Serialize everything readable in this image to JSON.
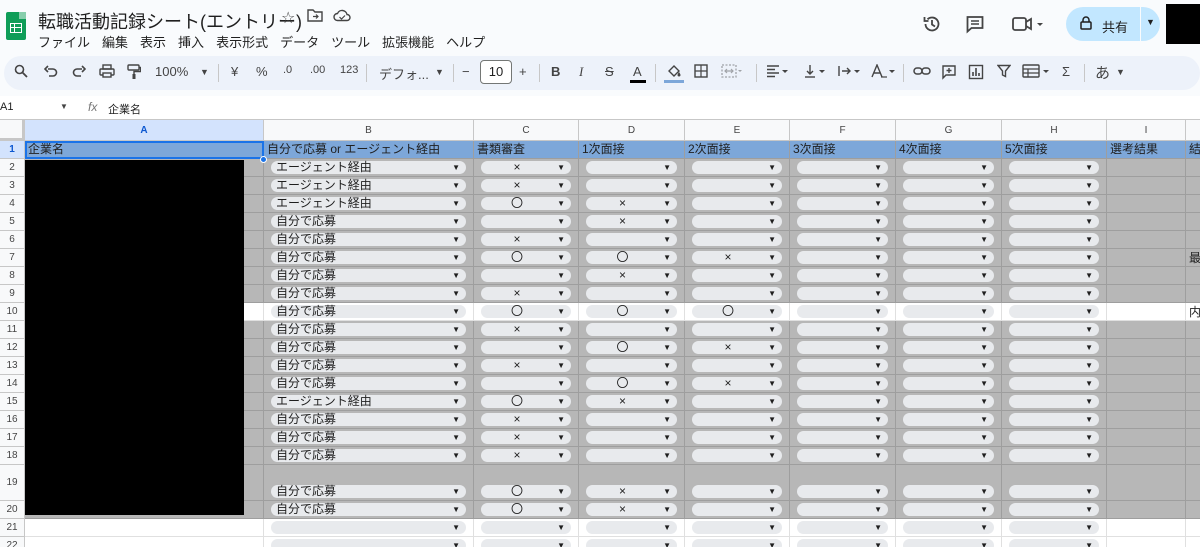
{
  "app": {
    "doc_title": "転職活動記録シート(エントリー)",
    "menu": [
      "ファイル",
      "編集",
      "表示",
      "挿入",
      "表示形式",
      "データ",
      "ツール",
      "拡張機能",
      "ヘルプ"
    ],
    "share_label": "共有"
  },
  "toolbar": {
    "zoom": "100%",
    "currency": "¥",
    "percent": "%",
    "dec_decrease": ".0",
    "dec_increase": ".00",
    "number_format": "123",
    "font": "デフォ...",
    "font_size": "10",
    "bold": "B",
    "italic": "I",
    "strike": "S",
    "text_color": "A",
    "ime": "あ"
  },
  "formula_bar": {
    "name_box": "A1",
    "fx": "fx",
    "value": "企業名"
  },
  "colors": {
    "header_fill": "#7da7d9",
    "row_fill": "#b7b7b7",
    "selection": "#1a73e8"
  },
  "sheet": {
    "columns": [
      "A",
      "B",
      "C",
      "D",
      "E",
      "F",
      "G",
      "H",
      "I"
    ],
    "header_row": [
      "企業名",
      "自分で応募 or エージェント経由",
      "書類審査",
      "1次面接",
      "2次面接",
      "3次面接",
      "4次面接",
      "5次面接",
      "選考結果",
      "結"
    ],
    "row_numbers": [
      "1",
      "2",
      "3",
      "4",
      "5",
      "6",
      "7",
      "8",
      "9",
      "10",
      "11",
      "12",
      "13",
      "14",
      "15",
      "16",
      "17",
      "18",
      "19",
      "20",
      "21",
      "22"
    ],
    "rows": [
      {
        "b": "エージェント経由",
        "c": "×",
        "d": "",
        "e": "",
        "j": ""
      },
      {
        "b": "エージェント経由",
        "c": "×",
        "d": "",
        "e": "",
        "j": ""
      },
      {
        "b": "エージェント経由",
        "c": "〇",
        "d": "×",
        "e": "",
        "j": ""
      },
      {
        "b": "自分で応募",
        "c": "",
        "d": "×",
        "e": "",
        "j": ""
      },
      {
        "b": "自分で応募",
        "c": "×",
        "d": "",
        "e": "",
        "j": ""
      },
      {
        "b": "自分で応募",
        "c": "〇",
        "d": "〇",
        "e": "×",
        "j": "最"
      },
      {
        "b": "自分で応募",
        "c": "",
        "d": "×",
        "e": "",
        "j": ""
      },
      {
        "b": "自分で応募",
        "c": "×",
        "d": "",
        "e": "",
        "j": ""
      },
      {
        "b": "自分で応募",
        "c": "〇",
        "d": "〇",
        "e": "〇",
        "j": "内"
      },
      {
        "b": "自分で応募",
        "c": "×",
        "d": "",
        "e": "",
        "j": ""
      },
      {
        "b": "自分で応募",
        "c": "",
        "d": "〇",
        "e": "×",
        "j": ""
      },
      {
        "b": "自分で応募",
        "c": "×",
        "d": "",
        "e": "",
        "j": ""
      },
      {
        "b": "自分で応募",
        "c": "",
        "d": "〇",
        "e": "×",
        "j": ""
      },
      {
        "b": "エージェント経由",
        "c": "〇",
        "d": "×",
        "e": "",
        "j": ""
      },
      {
        "b": "自分で応募",
        "c": "×",
        "d": "",
        "e": "",
        "j": ""
      },
      {
        "b": "自分で応募",
        "c": "×",
        "d": "",
        "e": "",
        "j": ""
      },
      {
        "b": "自分で応募",
        "c": "×",
        "d": "",
        "e": "",
        "j": ""
      },
      {
        "b": "自分で応募",
        "c": "〇",
        "d": "×",
        "e": "",
        "j": ""
      },
      {
        "b": "自分で応募",
        "c": "〇",
        "d": "×",
        "e": "",
        "j": ""
      },
      {
        "b": "",
        "c": "",
        "d": "",
        "e": "",
        "j": ""
      },
      {
        "b": "",
        "c": "",
        "d": "",
        "e": "",
        "j": ""
      }
    ]
  }
}
